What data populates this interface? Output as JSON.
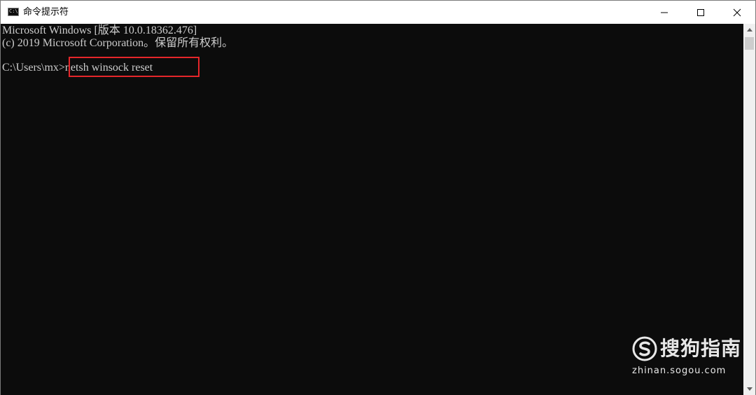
{
  "window": {
    "title": "命令提示符",
    "icon": "cmd-icon",
    "controls": {
      "minimize_icon": "minimize-icon",
      "maximize_icon": "maximize-icon",
      "close_icon": "close-icon"
    }
  },
  "console": {
    "lines": [
      "Microsoft Windows [版本 10.0.18362.476]",
      "(c) 2019 Microsoft Corporation。保留所有权利。",
      "C:\\Users\\mx>netsh winsock reset"
    ],
    "text_color": "#cccccc",
    "background_color": "#0c0c0c"
  },
  "highlight": {
    "color": "#e5262a"
  },
  "watermark": {
    "brand": "搜狗指南",
    "url": "zhinan.sogou.com"
  }
}
